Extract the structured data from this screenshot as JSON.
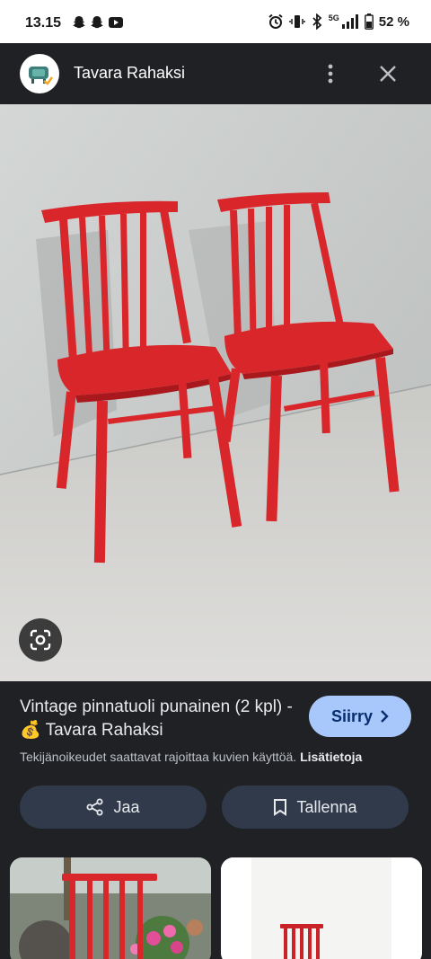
{
  "status_bar": {
    "time": "13.15",
    "battery": "52 %",
    "network": "5G"
  },
  "header": {
    "site_name": "Tavara Rahaksi",
    "logo_icon": "armchair-logo-icon",
    "menu_icon": "more-vert-icon",
    "close_icon": "close-icon"
  },
  "main_image": {
    "alt_subject": "two red spindle-back chairs",
    "lens_icon": "google-lens-icon"
  },
  "result": {
    "title": "Vintage pinnatuoli punainen (2 kpl) - 💰 Tavara Rahaksi",
    "visit_label": "Siirry",
    "copyright": "Tekijänoikeudet saattavat rajoittaa kuvien käyttöä.",
    "more_info": "Lisätietoja"
  },
  "actions": {
    "share_label": "Jaa",
    "save_label": "Tallenna"
  },
  "colors": {
    "accent_button": "#a8c7fa",
    "action_button": "#303a4a",
    "chair_red": "#d8262b",
    "panel_background": "#202124"
  }
}
